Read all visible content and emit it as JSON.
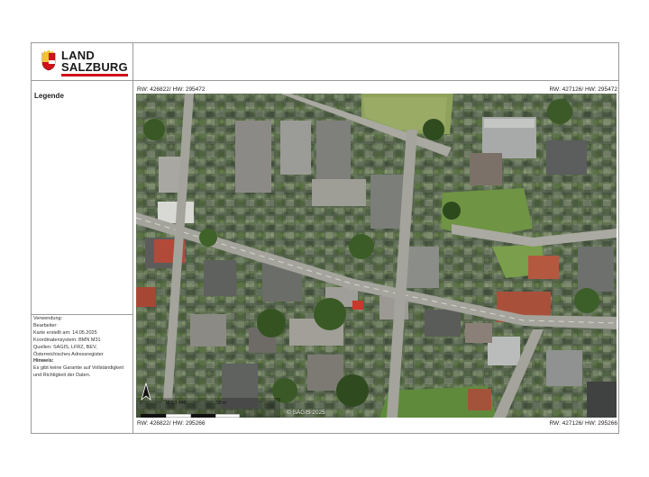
{
  "logo": {
    "line1": "LAND",
    "line2": "SALZBURG",
    "accent_color": "#d0121b"
  },
  "legend": {
    "title": "Legende"
  },
  "coordinates": {
    "top_left": "RW: 426822/ HW: 295472",
    "top_right": "RW: 427126/ HW: 295472",
    "bottom_left": "RW: 426822/ HW: 295266",
    "bottom_right": "RW: 427126/ HW: 295266"
  },
  "meta": {
    "usage": "Verwendung:",
    "editor": "Bearbeiter:",
    "created": "Karte erstellt am: 14.05.2025",
    "crs": "Koordinatensystem: BMN M31",
    "sources1": "Quellen: SAGIS, LFRZ, BEV,",
    "sources2": "Österreichisches Adressregister",
    "note_label": "Hinweis:",
    "note1": "Es gibt keine Garantie auf Vollständigkeit",
    "note2": "und Richtigkeit der Daten."
  },
  "map": {
    "scale_text": "M 1:1 440",
    "scale_zero": "0",
    "scale_end": "50 m",
    "north_symbol": "north-arrow",
    "copyright": "© SAGIS 2025"
  }
}
